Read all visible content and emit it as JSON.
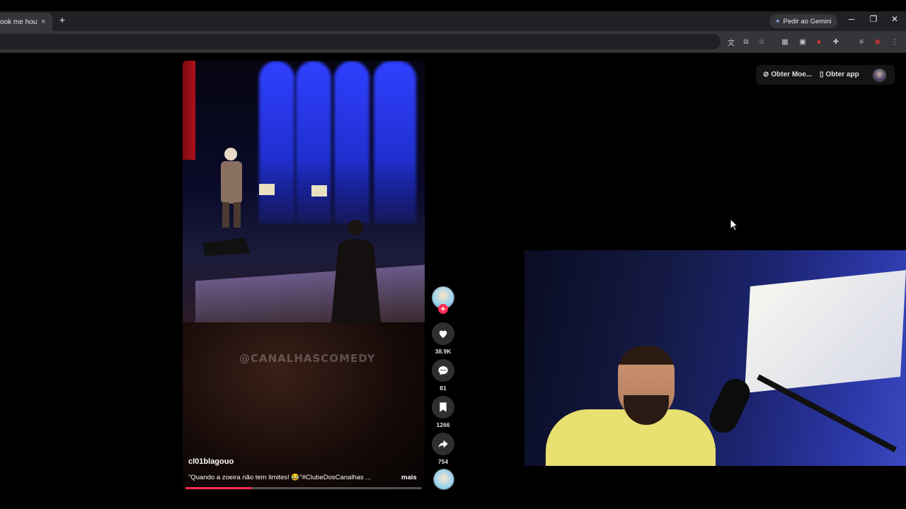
{
  "browser": {
    "tab_title": "ook me hours t",
    "tab_close": "×",
    "new_tab": "+",
    "gemini_label": "Pedir ao Gemini",
    "win_minimize": "─",
    "win_restore": "❐",
    "win_close": "✕"
  },
  "toolbar_icons": [
    "translate-icon",
    "cast-icon",
    "bookmark-star-icon",
    "extension-grid-icon",
    "tab-search-icon",
    "record-icon",
    "puzzle-icon",
    "media-icon",
    "profile-icon",
    "menu-icon"
  ],
  "video": {
    "watermark": "@CANALHASCOMEDY",
    "username": "cl01blagouo",
    "caption": "\"Quando a zoeira não tem limites! 😂\"#ClubeDosCanalhas ...",
    "more_label": "mais",
    "progress": 0.28
  },
  "actions": {
    "follow_symbol": "+",
    "likes": "38.9K",
    "comments": "81",
    "saves": "1266",
    "shares": "754"
  },
  "top_right": {
    "get_moe": "Obter Moe...",
    "get_app": "Obter app"
  },
  "colors": {
    "accent": "#fe2c55",
    "action_bg": "#2f2f2f"
  }
}
